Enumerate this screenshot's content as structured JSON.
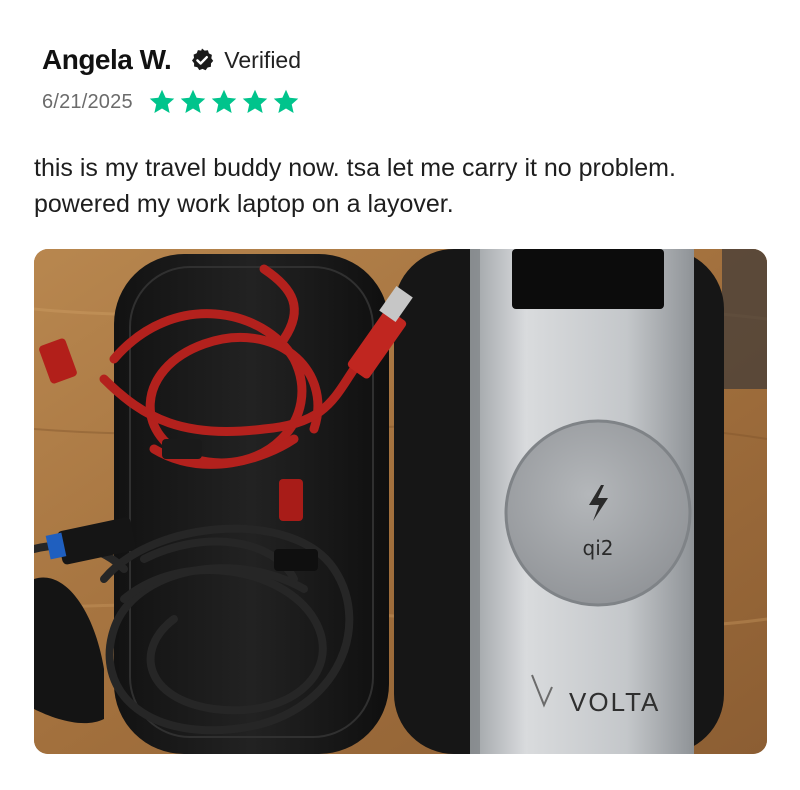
{
  "review": {
    "author": "Angela W.",
    "verified_label": "Verified",
    "date": "6/21/2025",
    "rating": 5,
    "rating_max": 5,
    "star_color": "#00c48c",
    "text": "this is my travel buddy now. tsa let me carry it no problem. powered my work laptop on a layover.",
    "photo": {
      "brand_text": "VOLTA",
      "charger_label": "qi2",
      "icon": "lightning-bolt-icon"
    }
  }
}
